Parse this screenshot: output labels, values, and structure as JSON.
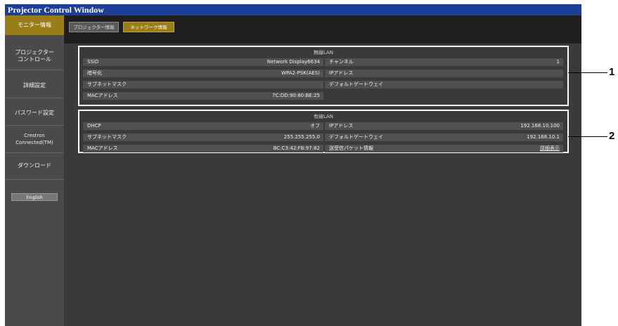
{
  "window": {
    "title": "Projector Control Window"
  },
  "tabs": [
    {
      "label": "プロジェクター情報"
    },
    {
      "label": "ネットワーク情報"
    }
  ],
  "sidebar": {
    "items": [
      {
        "label": "モニター情報"
      },
      {
        "label": "プロジェクター\nコントロール"
      },
      {
        "label": "詳細設定"
      },
      {
        "label": "パスワード設定"
      },
      {
        "label": "Crestron\nConnected(TM)"
      },
      {
        "label": "ダウンロード"
      }
    ],
    "english_button": "English"
  },
  "wireless": {
    "heading": "無線LAN",
    "rows": [
      {
        "left_label": "SSID",
        "left_value": "Network Display6634",
        "right_label": "チャンネル",
        "right_value": "1"
      },
      {
        "left_label": "暗号化",
        "left_value": "WPA2-PSK(AES)",
        "right_label": "IPアドレス",
        "right_value": ""
      },
      {
        "left_label": "サブネットマスク",
        "left_value": "",
        "right_label": "デフォルトゲートウェイ",
        "right_value": ""
      },
      {
        "left_label": "MACアドレス",
        "left_value": "7C:DD:90:80:BE:25"
      }
    ]
  },
  "wired": {
    "heading": "有線LAN",
    "rows": [
      {
        "left_label": "DHCP",
        "left_value": "オフ",
        "right_label": "IPアドレス",
        "right_value": "192.168.10.100"
      },
      {
        "left_label": "サブネットマスク",
        "left_value": "255.255.255.0",
        "right_label": "デフォルトゲートウェイ",
        "right_value": "192.168.10.1"
      },
      {
        "left_label": "MACアドレス",
        "left_value": "BC:C3:42:FB:97:82",
        "right_label": "送受信パケット情報",
        "right_value": "詳細表示"
      }
    ]
  },
  "callouts": [
    "1",
    "2"
  ]
}
